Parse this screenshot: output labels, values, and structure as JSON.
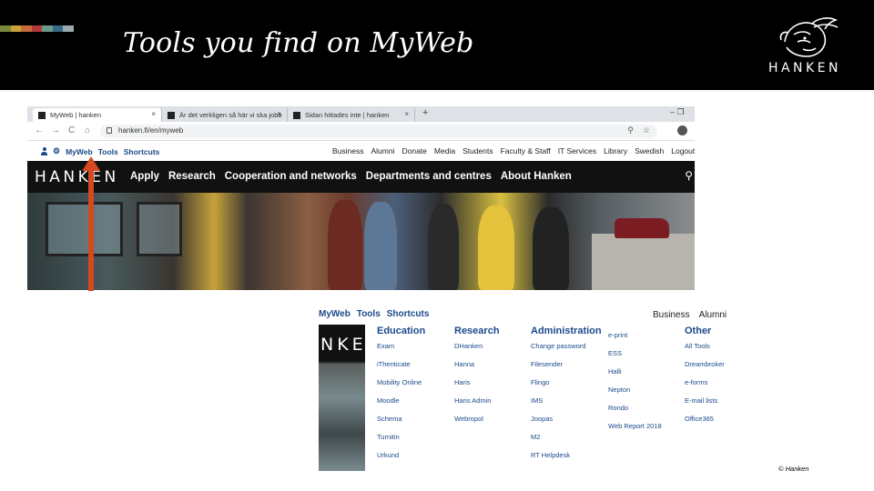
{
  "slide": {
    "title": "Tools you find on MyWeb",
    "brand": "HANKEN",
    "copyright": "© Hanken",
    "swatch_colors": [
      "#7a8a3a",
      "#c7a23a",
      "#c96a3a",
      "#b43a3a",
      "#6a9a8a",
      "#3a6a8a",
      "#9aaab0"
    ]
  },
  "browser": {
    "tabs": [
      {
        "label": "MyWeb | hanken",
        "close": "×"
      },
      {
        "label": "Är det verkligen så här vi ska jobb",
        "close": "×"
      },
      {
        "label": "Sidan hittades inte | hanken",
        "close": "×"
      }
    ],
    "new_tab": "+",
    "window_controls": "–   ❐",
    "nav": {
      "back": "←",
      "forward": "→",
      "reload": "C",
      "home": "⌂"
    },
    "url": "hanken.fi/en/myweb",
    "zoom": "⚲",
    "star": "☆"
  },
  "site": {
    "util_left": [
      "MyWeb",
      "Tools",
      "Shortcuts"
    ],
    "util_right": [
      "Business",
      "Alumni",
      "Donate",
      "Media",
      "Students",
      "Faculty & Staff",
      "IT Services",
      "Library",
      "Swedish",
      "Logout"
    ],
    "brand": "HANKEN",
    "nav_links": [
      "Apply",
      "Research",
      "Cooperation and networks",
      "Departments and centres",
      "About Hanken"
    ],
    "search_icon": "⚲"
  },
  "dropdown": {
    "util_left": [
      "MyWeb",
      "Tools",
      "Shortcuts"
    ],
    "util_right": [
      "Business",
      "Alumni"
    ],
    "brand_fragment": "NKE",
    "columns": [
      {
        "title": "Education",
        "items": [
          "Exam",
          "iThenticate",
          "Mobility Online",
          "Moodle",
          "Schema",
          "Turnitin",
          "Urkund"
        ]
      },
      {
        "title": "Research",
        "items": [
          "DHanken",
          "Hanna",
          "Haris",
          "Haris Admin",
          "Webropol"
        ]
      },
      {
        "title": "Administration",
        "items": [
          "Change password",
          "Filesender",
          "Flingo",
          "IMS",
          "Joopas",
          "M2",
          "RT Helpdesk"
        ]
      },
      {
        "title": "",
        "items": [
          "e-print",
          "ESS",
          "Halli",
          "Nepton",
          "Rondo",
          "Web Report 2018"
        ]
      },
      {
        "title": "Other",
        "items": [
          "All Tools",
          "Dreambroker",
          "e-forms",
          "E-mail lists",
          "Office365"
        ]
      }
    ]
  },
  "colors": {
    "accent_blue": "#1b4a8c",
    "arrow": "#d4491f"
  }
}
